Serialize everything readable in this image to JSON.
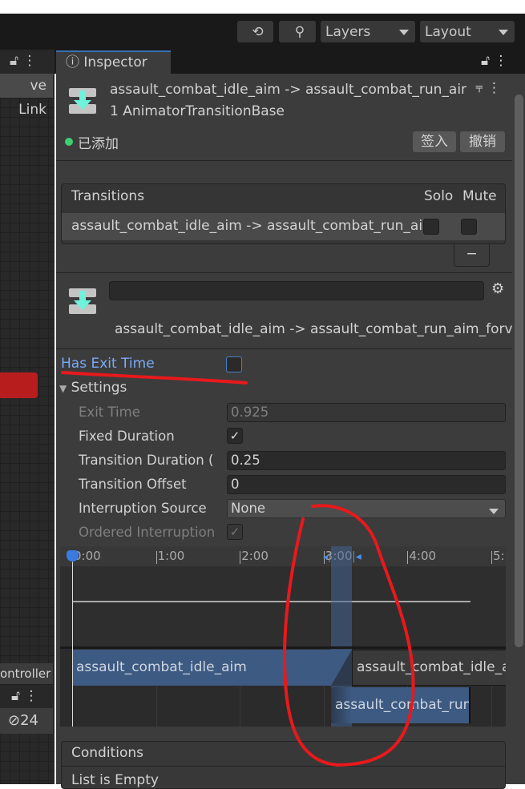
{
  "toolbar": {
    "history_icon": "history-icon",
    "search_icon": "search-icon",
    "layers": "Layers",
    "layout": "Layout"
  },
  "left_panel": {
    "live_link": "ve Link",
    "controller": "ontroller",
    "hidden_count": "24"
  },
  "inspector": {
    "tab_label": "Inspector",
    "header": {
      "title": "assault_combat_idle_aim -> assault_combat_run_air",
      "subtitle": "1 AnimatorTransitionBase",
      "status": "已添加",
      "checkin": "签入",
      "revert": "撤销"
    },
    "transitions": {
      "header": "Transitions",
      "solo": "Solo",
      "mute": "Mute",
      "items": [
        {
          "label": "assault_combat_idle_aim -> assault_combat_run_ai",
          "solo": false,
          "mute": false
        }
      ],
      "remove": "−"
    },
    "transition": {
      "name_value": "",
      "full_name": "assault_combat_idle_aim -> assault_combat_run_aim_forv"
    },
    "has_exit_time": {
      "label": "Has Exit Time",
      "checked": false
    },
    "settings": {
      "label": "Settings",
      "exit_time": {
        "label": "Exit Time",
        "value": "0.925"
      },
      "fixed_duration": {
        "label": "Fixed Duration",
        "checked": true
      },
      "transition_duration": {
        "label": "Transition Duration (",
        "value": "0.25"
      },
      "transition_offset": {
        "label": "Transition Offset",
        "value": "0"
      },
      "interruption_source": {
        "label": "Interruption Source",
        "value": "None"
      },
      "ordered_interruption": {
        "label": "Ordered Interruption",
        "checked": true
      }
    },
    "timeline": {
      "ticks": [
        "0:00",
        "1:00",
        "2:00",
        "3:00",
        "4:00",
        "5:"
      ],
      "clip_source": "assault_combat_idle_aim",
      "clip_source_repeat": "assault_combat_idle_a",
      "clip_dest": "assault_combat_run"
    },
    "conditions": {
      "header": "Conditions",
      "empty": "List is Empty"
    }
  },
  "colors": {
    "accent": "#7baaf7",
    "annotation": "#e8191c",
    "clip": "#3d5a82",
    "status_green": "#3ccf6e"
  }
}
